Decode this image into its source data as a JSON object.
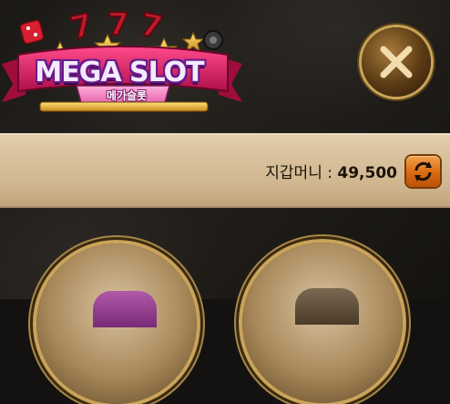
{
  "logo": {
    "title": "MEGA SLOT",
    "subtitle": "메가슬롯",
    "badge": "777"
  },
  "header": {
    "close_icon": "close-icon"
  },
  "wallet": {
    "label": "지갑머니 : ",
    "amount": "49,500",
    "refresh_icon": "refresh-icon"
  },
  "games": [
    {
      "icon": "game-thumbnail"
    },
    {
      "icon": "game-thumbnail"
    }
  ],
  "colors": {
    "gold": "#c9a45a",
    "banner_pink": "#d8206a",
    "wallet_bar": "#d9c29d",
    "refresh_orange": "#e07a1f"
  }
}
